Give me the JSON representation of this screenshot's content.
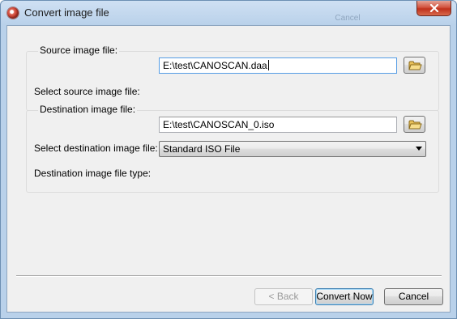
{
  "window": {
    "title": "Convert image file",
    "ghost_text": "Cancel"
  },
  "source": {
    "group_title": "Source image file:",
    "select_label": "Select source image file:",
    "path_value": "E:\\test\\CANOSCAN.daa"
  },
  "destination": {
    "group_title": "Destination image file:",
    "select_label": "Select destination image file:",
    "path_value": "E:\\test\\CANOSCAN_0.iso",
    "type_label": "Destination image file type:",
    "type_selected": "Standard ISO File"
  },
  "buttons": {
    "back": "< Back",
    "convert": "Convert Now",
    "cancel": "Cancel"
  },
  "icons": {
    "app": "app-disc-icon",
    "close": "close-icon",
    "browse": "folder-icon",
    "dropdown": "chevron-down-icon"
  },
  "colors": {
    "titlebar": "#b9d1ea",
    "close_button": "#c0311c",
    "dialog_bg": "#f0f0f0",
    "focus_border": "#569de5",
    "default_button_border": "#3c7fb1"
  }
}
